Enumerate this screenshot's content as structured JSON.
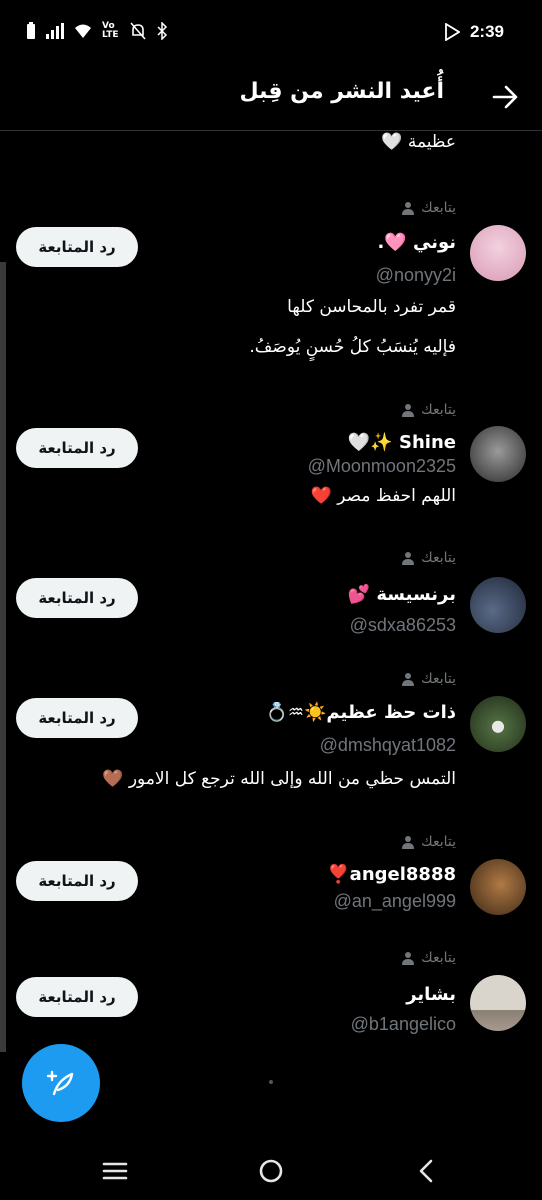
{
  "status": {
    "time": "2:39",
    "network": "Vo LTE"
  },
  "header": {
    "title": "أُعيد النشر من قِبل"
  },
  "previous_item_text": "عظيمة 🤍",
  "follows_label": "يتابعك",
  "follow_button_label": "رد المتابعة",
  "users": [
    {
      "name": "نوني 🩷.",
      "handle": "@nonyy2i",
      "bio": [
        "قمر تفرد بالمحاسن كلها",
        "فإليه يُنسَبُ كلُ حُسنٍ يُوصَفُ."
      ],
      "avatar_color": "#e8b3c6"
    },
    {
      "name": "Shine ✨🤍",
      "handle": "@Moonmoon2325",
      "bio": [
        "اللهم احفظ مصر ❤️"
      ],
      "avatar_color": "#555"
    },
    {
      "name": "برنسيسة 💕",
      "handle": "@sdxa86253",
      "bio": [],
      "avatar_color": "#3b4d66"
    },
    {
      "name": "ذات حظ عظيم☀️♒💍",
      "handle": "@dmshqyat1082",
      "bio": [
        "التمس حظي من الله وإلى الله ترجع كل الامور 🤎"
      ],
      "avatar_color": "#384a33"
    },
    {
      "name": "angel8888❣️",
      "handle": "@an_angel999",
      "bio": [],
      "avatar_color": "#6b4a2c"
    },
    {
      "name": "بشاير",
      "handle": "@b1angelico",
      "bio": [],
      "avatar_color": "#c9c4bd"
    }
  ]
}
